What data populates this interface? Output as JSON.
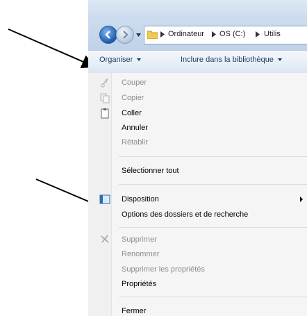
{
  "breadcrumb": {
    "items": [
      "Ordinateur",
      "OS (C:)",
      "Utilis"
    ]
  },
  "toolbar": {
    "organise_label": "Organiser",
    "include_label": "Inclure dans la bibliothèque"
  },
  "menu": {
    "items": [
      {
        "label": "Couper",
        "enabled": false,
        "icon": "scissors-icon"
      },
      {
        "label": "Copier",
        "enabled": false,
        "icon": "copy-icon"
      },
      {
        "label": "Coller",
        "enabled": true,
        "icon": "clipboard-icon"
      },
      {
        "label": "Annuler",
        "enabled": true
      },
      {
        "label": "Rétablir",
        "enabled": false
      },
      {
        "label": "Sélectionner tout",
        "enabled": true
      },
      {
        "label": "Disposition",
        "enabled": true,
        "icon": "layout-icon",
        "has_submenu": true
      },
      {
        "label": "Options des dossiers et de recherche",
        "enabled": true
      },
      {
        "label": "Supprimer",
        "enabled": false,
        "icon": "delete-x-icon"
      },
      {
        "label": "Renommer",
        "enabled": false
      },
      {
        "label": "Supprimer les propriétés",
        "enabled": false
      },
      {
        "label": "Propriétés",
        "enabled": true
      },
      {
        "label": "Fermer",
        "enabled": true
      }
    ]
  },
  "colors": {
    "disabled_text": "#8d8d8d",
    "toolbar_text": "#1e395b"
  }
}
